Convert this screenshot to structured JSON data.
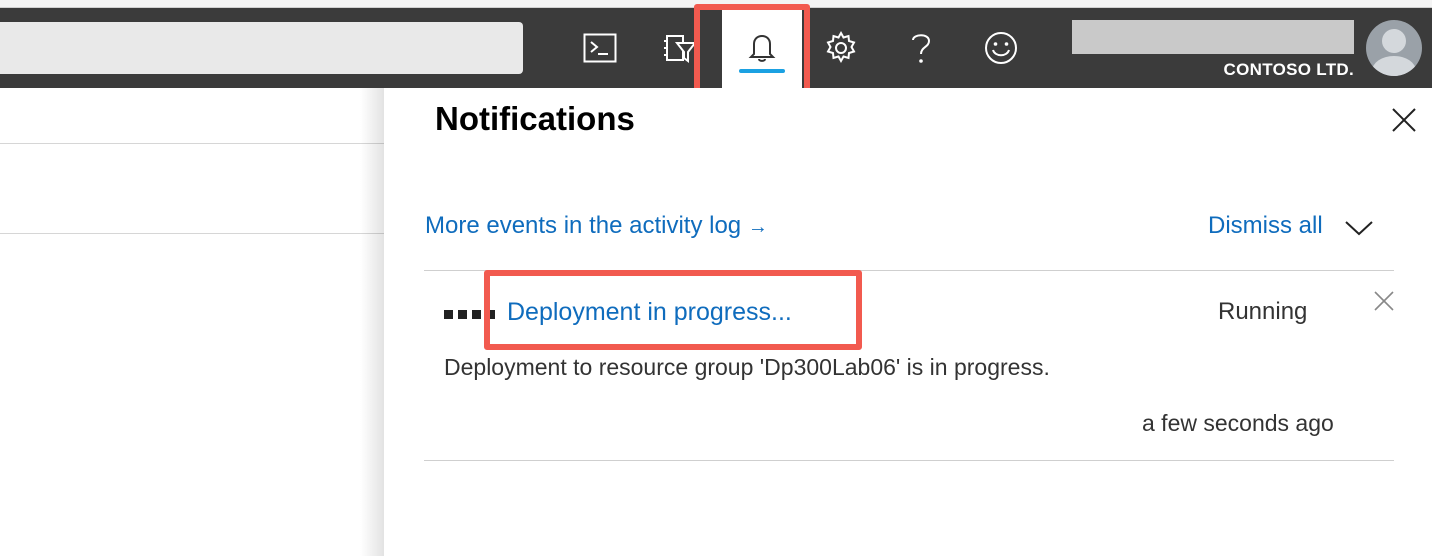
{
  "header": {
    "tenant": "CONTOSO LTD.",
    "icons": [
      "cloud-shell-icon",
      "directory-filter-icon",
      "notifications-bell-icon",
      "settings-gear-icon",
      "help-icon",
      "feedback-smiley-icon"
    ],
    "accent": "#1ba1e2",
    "highlight": "#f25a4f"
  },
  "panel": {
    "title": "Notifications",
    "activity_link": "More events in the activity log",
    "activity_arrow": "→",
    "dismiss_all": "Dismiss all"
  },
  "notification": {
    "title": "Deployment in progress...",
    "status": "Running",
    "description": "Deployment to resource group 'Dp300Lab06' is in progress.",
    "time": "a few seconds ago"
  }
}
